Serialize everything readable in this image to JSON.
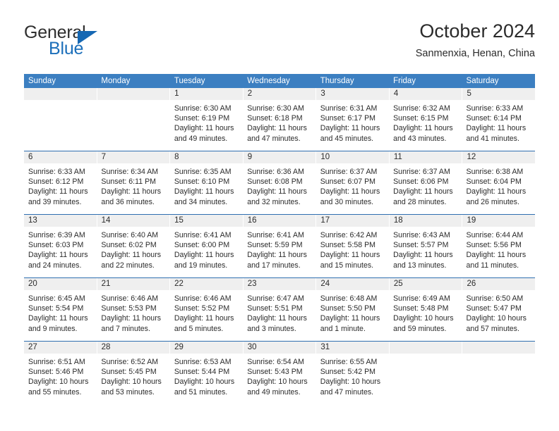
{
  "brand": {
    "name_part1": "General",
    "name_part2": "Blue"
  },
  "header": {
    "title": "October 2024",
    "subtitle": "Sanmenxia, Henan, China"
  },
  "weekday_headers": [
    "Sunday",
    "Monday",
    "Tuesday",
    "Wednesday",
    "Thursday",
    "Friday",
    "Saturday"
  ],
  "colors": {
    "header_blue": "#3c7fc1",
    "rule_blue": "#2f6fb0",
    "num_strip_gray": "#efefef",
    "logo_blue": "#1c6fba",
    "text": "#2b2b2b"
  },
  "weeks": [
    [
      {
        "day": "",
        "lines": []
      },
      {
        "day": "",
        "lines": []
      },
      {
        "day": "1",
        "lines": [
          "Sunrise: 6:30 AM",
          "Sunset: 6:19 PM",
          "Daylight: 11 hours",
          "and 49 minutes."
        ]
      },
      {
        "day": "2",
        "lines": [
          "Sunrise: 6:30 AM",
          "Sunset: 6:18 PM",
          "Daylight: 11 hours",
          "and 47 minutes."
        ]
      },
      {
        "day": "3",
        "lines": [
          "Sunrise: 6:31 AM",
          "Sunset: 6:17 PM",
          "Daylight: 11 hours",
          "and 45 minutes."
        ]
      },
      {
        "day": "4",
        "lines": [
          "Sunrise: 6:32 AM",
          "Sunset: 6:15 PM",
          "Daylight: 11 hours",
          "and 43 minutes."
        ]
      },
      {
        "day": "5",
        "lines": [
          "Sunrise: 6:33 AM",
          "Sunset: 6:14 PM",
          "Daylight: 11 hours",
          "and 41 minutes."
        ]
      }
    ],
    [
      {
        "day": "6",
        "lines": [
          "Sunrise: 6:33 AM",
          "Sunset: 6:12 PM",
          "Daylight: 11 hours",
          "and 39 minutes."
        ]
      },
      {
        "day": "7",
        "lines": [
          "Sunrise: 6:34 AM",
          "Sunset: 6:11 PM",
          "Daylight: 11 hours",
          "and 36 minutes."
        ]
      },
      {
        "day": "8",
        "lines": [
          "Sunrise: 6:35 AM",
          "Sunset: 6:10 PM",
          "Daylight: 11 hours",
          "and 34 minutes."
        ]
      },
      {
        "day": "9",
        "lines": [
          "Sunrise: 6:36 AM",
          "Sunset: 6:08 PM",
          "Daylight: 11 hours",
          "and 32 minutes."
        ]
      },
      {
        "day": "10",
        "lines": [
          "Sunrise: 6:37 AM",
          "Sunset: 6:07 PM",
          "Daylight: 11 hours",
          "and 30 minutes."
        ]
      },
      {
        "day": "11",
        "lines": [
          "Sunrise: 6:37 AM",
          "Sunset: 6:06 PM",
          "Daylight: 11 hours",
          "and 28 minutes."
        ]
      },
      {
        "day": "12",
        "lines": [
          "Sunrise: 6:38 AM",
          "Sunset: 6:04 PM",
          "Daylight: 11 hours",
          "and 26 minutes."
        ]
      }
    ],
    [
      {
        "day": "13",
        "lines": [
          "Sunrise: 6:39 AM",
          "Sunset: 6:03 PM",
          "Daylight: 11 hours",
          "and 24 minutes."
        ]
      },
      {
        "day": "14",
        "lines": [
          "Sunrise: 6:40 AM",
          "Sunset: 6:02 PM",
          "Daylight: 11 hours",
          "and 22 minutes."
        ]
      },
      {
        "day": "15",
        "lines": [
          "Sunrise: 6:41 AM",
          "Sunset: 6:00 PM",
          "Daylight: 11 hours",
          "and 19 minutes."
        ]
      },
      {
        "day": "16",
        "lines": [
          "Sunrise: 6:41 AM",
          "Sunset: 5:59 PM",
          "Daylight: 11 hours",
          "and 17 minutes."
        ]
      },
      {
        "day": "17",
        "lines": [
          "Sunrise: 6:42 AM",
          "Sunset: 5:58 PM",
          "Daylight: 11 hours",
          "and 15 minutes."
        ]
      },
      {
        "day": "18",
        "lines": [
          "Sunrise: 6:43 AM",
          "Sunset: 5:57 PM",
          "Daylight: 11 hours",
          "and 13 minutes."
        ]
      },
      {
        "day": "19",
        "lines": [
          "Sunrise: 6:44 AM",
          "Sunset: 5:56 PM",
          "Daylight: 11 hours",
          "and 11 minutes."
        ]
      }
    ],
    [
      {
        "day": "20",
        "lines": [
          "Sunrise: 6:45 AM",
          "Sunset: 5:54 PM",
          "Daylight: 11 hours",
          "and 9 minutes."
        ]
      },
      {
        "day": "21",
        "lines": [
          "Sunrise: 6:46 AM",
          "Sunset: 5:53 PM",
          "Daylight: 11 hours",
          "and 7 minutes."
        ]
      },
      {
        "day": "22",
        "lines": [
          "Sunrise: 6:46 AM",
          "Sunset: 5:52 PM",
          "Daylight: 11 hours",
          "and 5 minutes."
        ]
      },
      {
        "day": "23",
        "lines": [
          "Sunrise: 6:47 AM",
          "Sunset: 5:51 PM",
          "Daylight: 11 hours",
          "and 3 minutes."
        ]
      },
      {
        "day": "24",
        "lines": [
          "Sunrise: 6:48 AM",
          "Sunset: 5:50 PM",
          "Daylight: 11 hours",
          "and 1 minute."
        ]
      },
      {
        "day": "25",
        "lines": [
          "Sunrise: 6:49 AM",
          "Sunset: 5:48 PM",
          "Daylight: 10 hours",
          "and 59 minutes."
        ]
      },
      {
        "day": "26",
        "lines": [
          "Sunrise: 6:50 AM",
          "Sunset: 5:47 PM",
          "Daylight: 10 hours",
          "and 57 minutes."
        ]
      }
    ],
    [
      {
        "day": "27",
        "lines": [
          "Sunrise: 6:51 AM",
          "Sunset: 5:46 PM",
          "Daylight: 10 hours",
          "and 55 minutes."
        ]
      },
      {
        "day": "28",
        "lines": [
          "Sunrise: 6:52 AM",
          "Sunset: 5:45 PM",
          "Daylight: 10 hours",
          "and 53 minutes."
        ]
      },
      {
        "day": "29",
        "lines": [
          "Sunrise: 6:53 AM",
          "Sunset: 5:44 PM",
          "Daylight: 10 hours",
          "and 51 minutes."
        ]
      },
      {
        "day": "30",
        "lines": [
          "Sunrise: 6:54 AM",
          "Sunset: 5:43 PM",
          "Daylight: 10 hours",
          "and 49 minutes."
        ]
      },
      {
        "day": "31",
        "lines": [
          "Sunrise: 6:55 AM",
          "Sunset: 5:42 PM",
          "Daylight: 10 hours",
          "and 47 minutes."
        ]
      },
      {
        "day": "",
        "lines": []
      },
      {
        "day": "",
        "lines": []
      }
    ]
  ]
}
